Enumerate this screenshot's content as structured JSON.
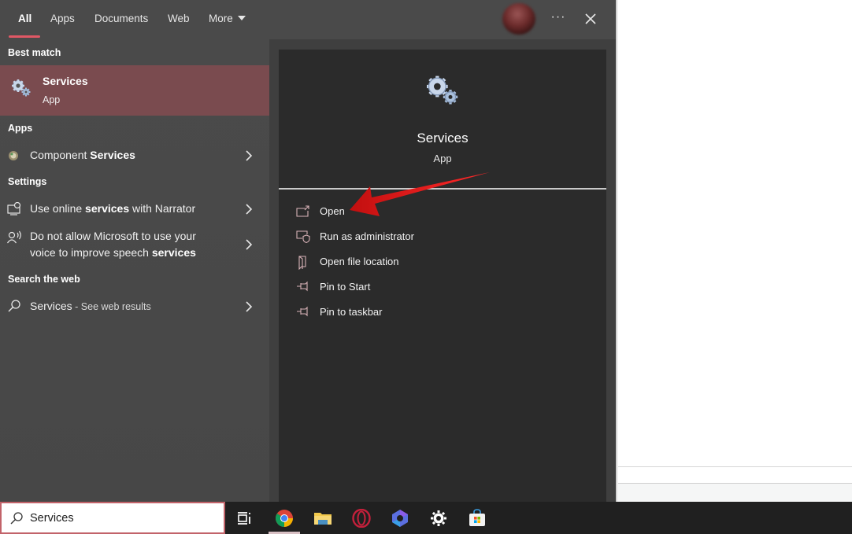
{
  "tabs": [
    {
      "label": "All",
      "active": true
    },
    {
      "label": "Apps",
      "active": false
    },
    {
      "label": "Documents",
      "active": false
    },
    {
      "label": "Web",
      "active": false
    },
    {
      "label": "More",
      "active": false
    }
  ],
  "header_icons": {
    "avatar": "user-avatar",
    "more": "···",
    "close": "close-icon"
  },
  "sections": {
    "best_match": "Best match",
    "apps": "Apps",
    "settings": "Settings",
    "search_web": "Search the web"
  },
  "best_match": {
    "title": "Services",
    "subtitle": "App",
    "icon": "gears-icon"
  },
  "apps": [
    {
      "prefix": "Component ",
      "bold": "Services",
      "icon": "component-services-icon"
    }
  ],
  "settings": [
    {
      "prefix": "Use online ",
      "bold": "services",
      "suffix": " with Narrator",
      "icon": "narrator-icon"
    },
    {
      "line1": "Do not allow Microsoft to use your",
      "line2_prefix": "voice to improve speech ",
      "line2_bold": "services",
      "icon": "speech-icon"
    }
  ],
  "web": {
    "query": "Services",
    "hint": " - See web results",
    "icon": "search-icon"
  },
  "detail": {
    "title": "Services",
    "subtitle": "App",
    "actions": [
      {
        "label": "Open",
        "icon": "open-icon"
      },
      {
        "label": "Run as administrator",
        "icon": "admin-shield-icon"
      },
      {
        "label": "Open file location",
        "icon": "file-location-icon"
      },
      {
        "label": "Pin to Start",
        "icon": "pin-icon"
      },
      {
        "label": "Pin to taskbar",
        "icon": "pin-icon"
      }
    ]
  },
  "taskbar": {
    "search_value": "Services",
    "apps": [
      "task-view",
      "chrome",
      "file-explorer",
      "opera",
      "microsoft-365",
      "settings",
      "microsoft-store"
    ]
  },
  "colors": {
    "accent": "#e05865",
    "selected_bg": "#7a4b4f",
    "arrow": "#e01b1b"
  }
}
